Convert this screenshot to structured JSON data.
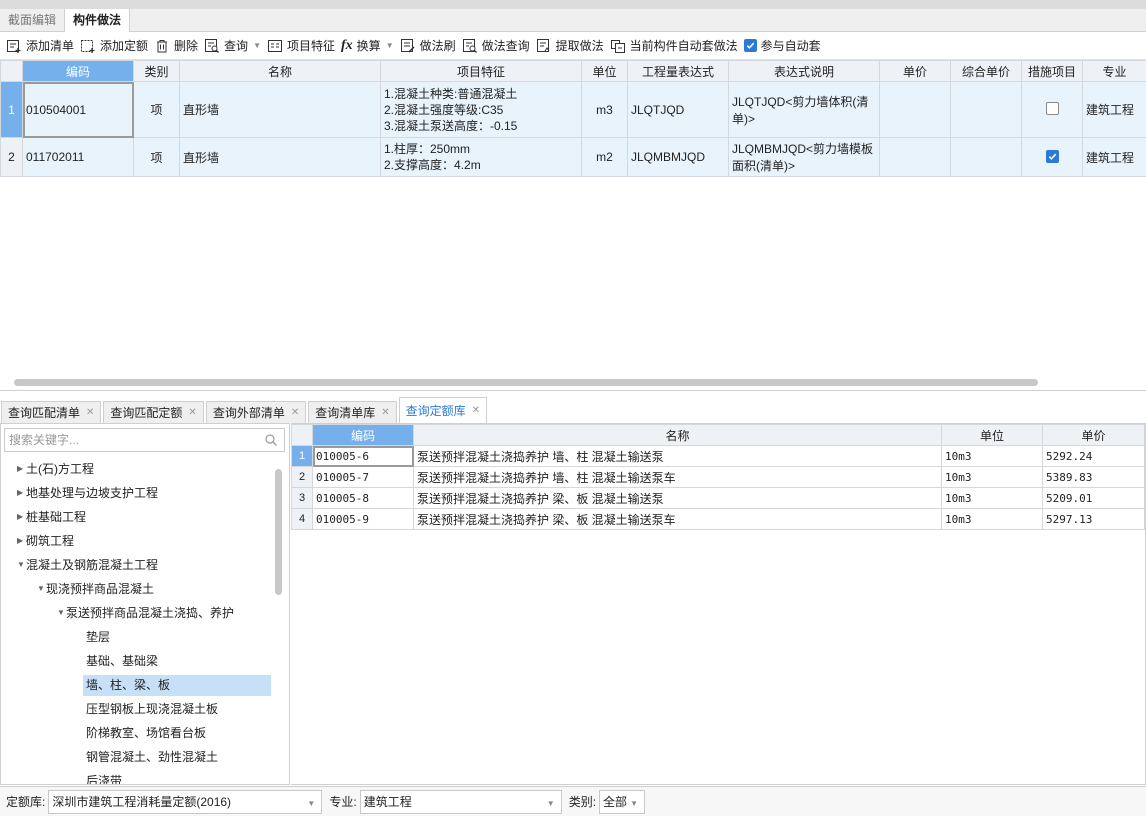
{
  "main_tabs": [
    "截面编辑",
    "构件做法"
  ],
  "toolbar": {
    "add_list": "添加清单",
    "add_quota": "添加定额",
    "delete": "删除",
    "query": "查询",
    "item_feature": "项目特征",
    "convert": "换算",
    "method_brush": "做法刷",
    "method_query": "做法查询",
    "extract_method": "提取做法",
    "auto_apply": "当前构件自动套做法",
    "participate_auto": "参与自动套",
    "participate_auto_checked": true
  },
  "upper_table": {
    "headers": [
      "编码",
      "类别",
      "名称",
      "项目特征",
      "单位",
      "工程量表达式",
      "表达式说明",
      "单价",
      "综合单价",
      "措施项目",
      "专业"
    ],
    "rows": [
      {
        "num": "1",
        "code": "010504001",
        "type": "项",
        "name": "直形墙",
        "features": [
          "1.混凝土种类:普通混凝土",
          "2.混凝土强度等级:C35",
          "3.混凝土泵送高度：-0.15"
        ],
        "unit": "m3",
        "expr": "JLQTJQD",
        "expr_desc": "JLQTJQD<剪力墙体积(清单)>",
        "price": "",
        "composite_price": "",
        "measure": false,
        "major": "建筑工程"
      },
      {
        "num": "2",
        "code": "011702011",
        "type": "项",
        "name": "直形墙",
        "features": [
          "1.柱厚：250mm",
          "2.支撑高度：4.2m"
        ],
        "unit": "m2",
        "expr": "JLQMBMJQD",
        "expr_desc": "JLQMBMJQD<剪力墙模板面积(清单)>",
        "price": "",
        "composite_price": "",
        "measure": true,
        "major": "建筑工程"
      }
    ]
  },
  "bottom_tabs": [
    "查询匹配清单",
    "查询匹配定额",
    "查询外部清单",
    "查询清单库",
    "查询定额库"
  ],
  "search": {
    "placeholder": "搜索关键字..."
  },
  "tree": [
    {
      "label": "土(石)方工程",
      "level": 0,
      "arrow": "right"
    },
    {
      "label": "地基处理与边坡支护工程",
      "level": 0,
      "arrow": "right"
    },
    {
      "label": "桩基础工程",
      "level": 0,
      "arrow": "right"
    },
    {
      "label": "砌筑工程",
      "level": 0,
      "arrow": "right"
    },
    {
      "label": "混凝土及钢筋混凝土工程",
      "level": 0,
      "arrow": "down"
    },
    {
      "label": "现浇预拌商品混凝土",
      "level": 1,
      "arrow": "down"
    },
    {
      "label": "泵送预拌商品混凝土浇捣、养护",
      "level": 2,
      "arrow": "down"
    },
    {
      "label": "垫层",
      "level": 3,
      "arrow": ""
    },
    {
      "label": "基础、基础梁",
      "level": 3,
      "arrow": ""
    },
    {
      "label": "墙、柱、梁、板",
      "level": 3,
      "arrow": "",
      "selected": true
    },
    {
      "label": "压型钢板上现浇混凝土板",
      "level": 3,
      "arrow": ""
    },
    {
      "label": "阶梯教室、场馆看台板",
      "level": 3,
      "arrow": ""
    },
    {
      "label": "钢管混凝土、劲性混凝土",
      "level": 3,
      "arrow": ""
    },
    {
      "label": "后浇带",
      "level": 3,
      "arrow": ""
    }
  ],
  "lower_table": {
    "headers": [
      "编码",
      "名称",
      "单位",
      "单价"
    ],
    "rows": [
      {
        "num": "1",
        "code": "010005-6",
        "name": "泵送预拌混凝土浇捣养护 墙、柱 混凝土输送泵",
        "unit": "10m3",
        "price": "5292.24"
      },
      {
        "num": "2",
        "code": "010005-7",
        "name": "泵送预拌混凝土浇捣养护 墙、柱 混凝土输送泵车",
        "unit": "10m3",
        "price": "5389.83"
      },
      {
        "num": "3",
        "code": "010005-8",
        "name": "泵送预拌混凝土浇捣养护 梁、板 混凝土输送泵",
        "unit": "10m3",
        "price": "5209.01"
      },
      {
        "num": "4",
        "code": "010005-9",
        "name": "泵送预拌混凝土浇捣养护 梁、板 混凝土输送泵车",
        "unit": "10m3",
        "price": "5297.13"
      }
    ]
  },
  "footer": {
    "quota_label": "定额库:",
    "quota_value": "深圳市建筑工程消耗量定额(2016)",
    "major_label": "专业:",
    "major_value": "建筑工程",
    "category_label": "类别:",
    "category_value": "全部"
  },
  "colors": {
    "accent": "#2d7ad6",
    "selected_header": "#76b0ec",
    "row_bg": "#e8f3fc"
  }
}
